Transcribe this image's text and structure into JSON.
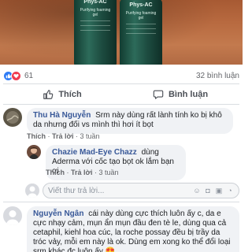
{
  "post": {
    "photo": {
      "bottles": [
        {
          "brand": "Phys-AC",
          "sub": "Purifying foaming gel"
        },
        {
          "brand": "Phys-AC",
          "sub": "Purifying foaming gel"
        }
      ]
    },
    "stats": {
      "reactions_count": "61",
      "comments_count": "32 bình luận"
    },
    "actions": {
      "like_label": "Thích",
      "comment_label": "Bình luận"
    }
  },
  "comments": [
    {
      "author": "Thu Hà Nguyễn",
      "text": "Srm này dùng rất lành tính ko bị khô da nhưng đối vs mình thì hơi ít bọt",
      "meta": {
        "like": "Thích",
        "reply": "Trả lời",
        "time": "3 tuần"
      }
    },
    {
      "author": "Chazie Mad-Eye Chazz",
      "text": "dùng Aderma với cốc tạo bọt ok lắm bạn ơi",
      "meta": {
        "like": "Thích",
        "reply": "Trả lời",
        "time": "3 tuần"
      }
    },
    {
      "author": "Nguyễn Ngân",
      "text": "cái này dùng cực thích luôn ấy c, da e cực nhạy cảm, mụn ẩn mụn đầu đen tè le, dùng qua cả cetaphil, kiehl hoa cúc, la roche possay đều bị trầy da tróc vảy, mỗi em này là ok. Dùng em xong ko thể đổi loại srm khác đc luôn ấy 😍"
    }
  ],
  "reply_input": {
    "placeholder": "Viết thư trả lời..."
  }
}
